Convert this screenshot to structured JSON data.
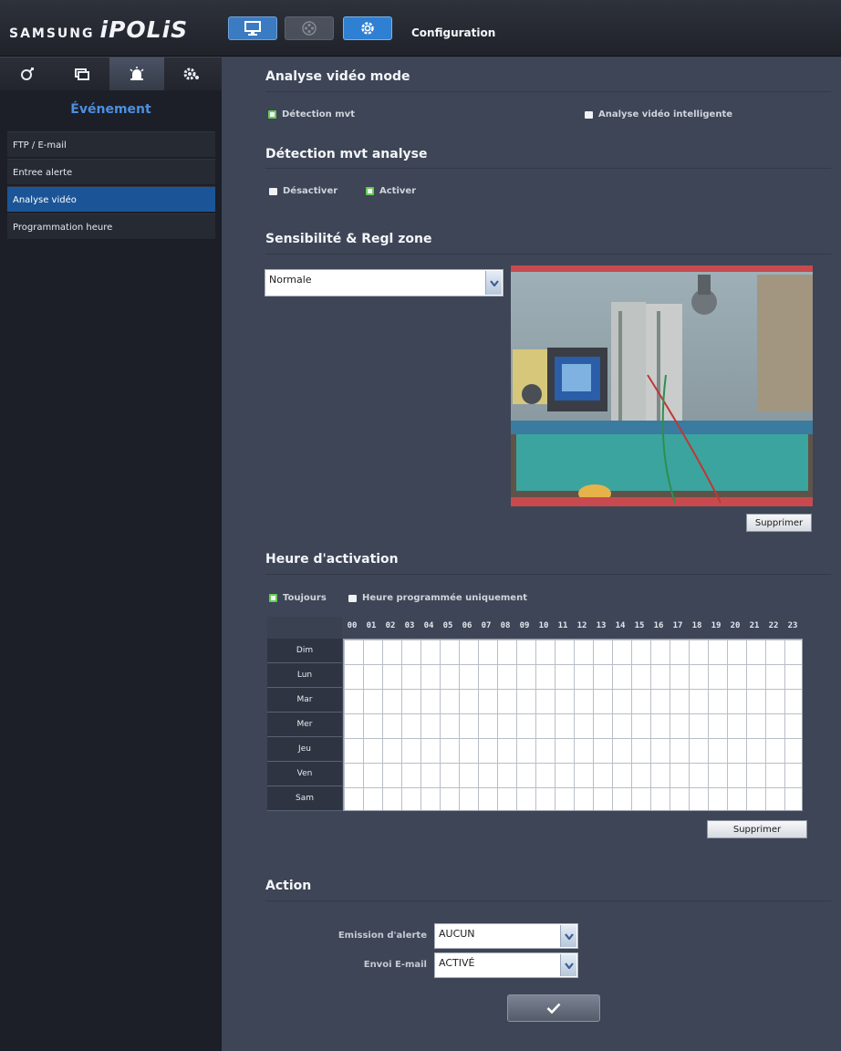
{
  "header": {
    "brand": "SAMSUNG",
    "product": "iPOLiS",
    "title": "Configuration",
    "icons": [
      "monitor-icon",
      "playback-icon",
      "settings-icon"
    ]
  },
  "sidebar": {
    "tabs": [
      {
        "icon": "network-icon",
        "active": false
      },
      {
        "icon": "video-icon",
        "active": false
      },
      {
        "icon": "alarm-icon",
        "active": true
      },
      {
        "icon": "system-icon",
        "active": false
      }
    ],
    "section": "Événement",
    "items": [
      {
        "label": "FTP / E-mail",
        "active": false
      },
      {
        "label": "Entree alerte",
        "active": false
      },
      {
        "label": "Analyse vidéo",
        "active": true
      },
      {
        "label": "Programmation heure",
        "active": false
      }
    ]
  },
  "mode": {
    "title": "Analyse vidéo mode",
    "options": [
      {
        "label": "Détection mvt",
        "checked": true
      },
      {
        "label": "Analyse vidéo intelligente",
        "checked": false
      }
    ]
  },
  "detection": {
    "title": "Détection mvt analyse",
    "options": [
      {
        "label": "Désactiver",
        "checked": false
      },
      {
        "label": "Activer",
        "checked": true
      }
    ]
  },
  "sensitivity": {
    "title": "Sensibilité & Regl zone",
    "value": "Normale",
    "delete_label": "Supprimer"
  },
  "activation": {
    "title": "Heure d'activation",
    "options": [
      {
        "label": "Toujours",
        "checked": true
      },
      {
        "label": "Heure programmée uniquement",
        "checked": false
      }
    ],
    "hours": [
      "00",
      "01",
      "02",
      "03",
      "04",
      "05",
      "06",
      "07",
      "08",
      "09",
      "10",
      "11",
      "12",
      "13",
      "14",
      "15",
      "16",
      "17",
      "18",
      "19",
      "20",
      "21",
      "22",
      "23"
    ],
    "days": [
      "Dim",
      "Lun",
      "Mar",
      "Mer",
      "Jeu",
      "Ven",
      "Sam"
    ],
    "delete_label": "Supprimer"
  },
  "action": {
    "title": "Action",
    "alert_label": "Emission d'alerte",
    "alert_value": "AUCUN",
    "email_label": "Envoi E-mail",
    "email_value": "ACTIVÉ"
  },
  "colors": {
    "accent": "#2f80d3",
    "active_item": "#1b5597",
    "check": "#66cc55",
    "zone": "#2ec4c0"
  }
}
